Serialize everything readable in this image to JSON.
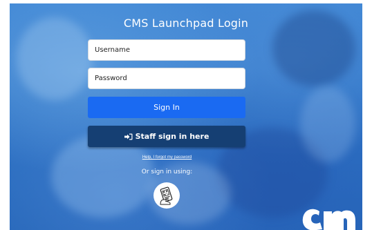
{
  "page": {
    "title": "CMS Launchpad Login"
  },
  "form": {
    "username_placeholder": "Username",
    "password_placeholder": "Password",
    "signin_label": "Sign In",
    "staff_label": "Staff sign in here",
    "forgot_link": "Help, I forgot my password",
    "alt_signin_text": "Or sign in using:"
  },
  "icons": {
    "staff": "sign-in-icon",
    "badge": "qr-badge-icon",
    "logo": "cms-logo"
  },
  "colors": {
    "primary_button": "#1a6af2",
    "staff_button": "#153f73",
    "background": "#2f74c6"
  }
}
